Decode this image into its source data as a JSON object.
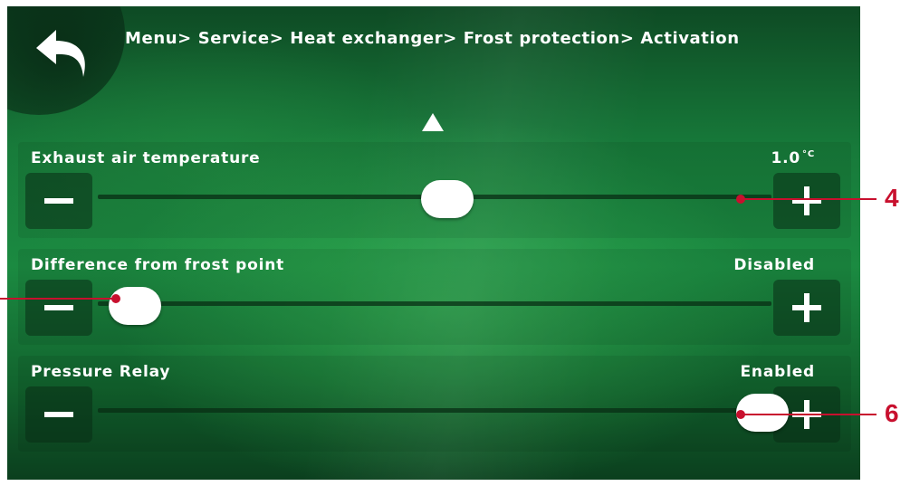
{
  "header": {
    "back_icon": "back-arrow-icon",
    "breadcrumb": "Menu> Service> Heat exchanger> Frost protection> Activation"
  },
  "scroll_up_icon": "triangle-up-icon",
  "rows": [
    {
      "label": "Exhaust air temperature",
      "value": "1.0",
      "unit": "°C",
      "slider_position": 0.5
    },
    {
      "label": "Difference from frost point",
      "value": "Disabled",
      "unit": "",
      "slider_position": 0.0
    },
    {
      "label": "Pressure Relay",
      "value": "Enabled",
      "unit": "",
      "slider_position": 1.0
    }
  ],
  "callouts": [
    {
      "number": "4"
    },
    {
      "number": "6"
    }
  ],
  "colors": {
    "background_green": "#1b8a41",
    "text": "#ffffff",
    "callout": "#c8102e"
  }
}
